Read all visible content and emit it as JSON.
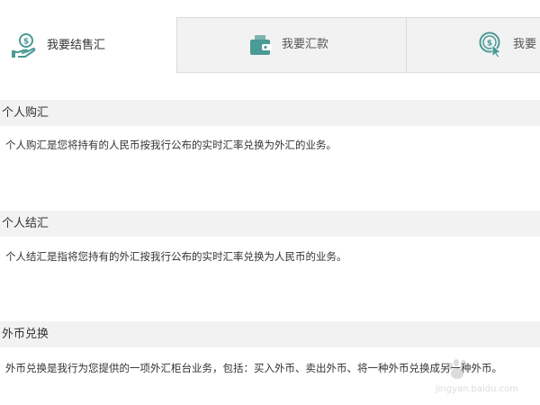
{
  "tabs": [
    {
      "label": "我要结售汇",
      "icon": "person-money-icon",
      "active": true
    },
    {
      "label": "我要汇款",
      "icon": "wallet-icon",
      "active": false
    },
    {
      "label": "我要",
      "icon": "dollar-click-icon",
      "active": false
    }
  ],
  "sections": [
    {
      "title": "个人购汇",
      "body": "个人购汇是您将持有的人民币按我行公布的实时汇率兑换为外汇的业务。"
    },
    {
      "title": "个人结汇",
      "body": "个人结汇是指将您持有的外汇按我行公布的实时汇率兑换为人民币的业务。"
    },
    {
      "title": "外币兑换",
      "body": "外币兑换是我行为您提供的一项外汇柜台业务，包括：买入外币、卖出外币、将一种外币兑换成另一种外币。"
    }
  ],
  "watermark": {
    "text": "jingyan.baidu.com"
  },
  "colors": {
    "icon_teal": "#4a9a96",
    "tab_bg": "#f2f2f2",
    "section_bg": "#f2f2f2"
  }
}
